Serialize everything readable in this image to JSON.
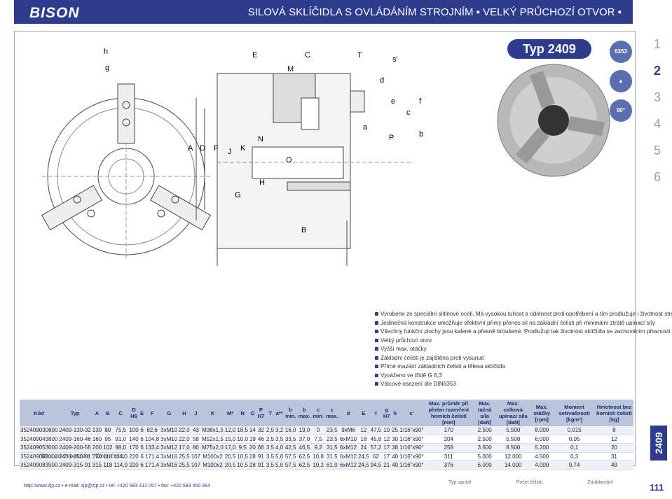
{
  "header": {
    "logo": "BISON",
    "title": "SILOVÁ SKLÍČIDLA S OVLÁDÁNÍM STROJNÍM ▪ VELKÝ PRŮCHOZÍ OTVOR ▪"
  },
  "side_tabs": [
    "1",
    "2",
    "3",
    "4",
    "5",
    "6"
  ],
  "active_tab": "2",
  "code_tab": "2409",
  "typ_label": "Typ 2409",
  "badges": {
    "din": "6353",
    "deg": "90°"
  },
  "drawing_labels": {
    "h": "h",
    "g": "g",
    "E": "E",
    "C": "C",
    "T": "T",
    "s": "s'",
    "M": "M",
    "d": "d",
    "e": "e",
    "c": "c",
    "f": "f",
    "a": "a",
    "P": "P",
    "b": "b",
    "A": "A",
    "D": "D",
    "F": "F",
    "J": "J",
    "K": "K",
    "N": "N",
    "O": "O",
    "G": "G",
    "H": "H",
    "B": "B"
  },
  "features": [
    "Vyrobeno ze speciální slitinové oceli. Má vysokou tuhost a odolnost proti opotřebení a tím prodlužuje i životnost stroje",
    "Jedinečná konstrukce umožňuje efektivní přímý přenos sil na základní čelisti při minimální ztrátě upínací síly",
    "Všechny funkční plochy jsou kalené a přesně broušené. Prodlužují tak životnost sklíčidla se zachováním přesnosti upínání",
    "Velký průchozí otvor",
    "Vyšší max. otáčky",
    "Základní čelisti je zajištěna proti vysunutí",
    "Přímé mazání základních čelistí a tělesa sklíčidla",
    "Vyváženo ve třídě G 6,3",
    "Válcové osazení dle DIN6353"
  ],
  "table": {
    "headers": [
      "Kód",
      "Typ",
      "A",
      "B",
      "C",
      "D H6",
      "E",
      "F",
      "G",
      "H",
      "J",
      "K",
      "M*",
      "N",
      "O",
      "P H7",
      "T",
      "a**",
      "b min.",
      "b max.",
      "c min.",
      "c max.",
      "d",
      "E",
      "f",
      "g H7",
      "h",
      "s'",
      "Max. průměr při plném rozevření horních čelistí [mm]",
      "Max. tažná síla [daN]",
      "Max. celková upínací síla [daN]",
      "Max. otáčky [rpm]",
      "Moment setrvačnosti [kgm²]",
      "Hmotnost bez horních čelistí [kg]"
    ],
    "rows": [
      [
        "352409030800",
        "2409-130-32",
        "130",
        "80",
        "75,5",
        "100",
        "6",
        "82,6",
        "3xM10",
        "22,0",
        "43",
        "M38x1,5",
        "12,0",
        "18,5",
        "14",
        "32",
        "2,5",
        "3,2",
        "16,0",
        "19,0",
        "0",
        "23,5",
        "9xM6",
        "12",
        "47,5",
        "10",
        "25",
        "1/16\"x90°",
        "170",
        "2.500",
        "5.500",
        "8.000",
        "0,015",
        "8"
      ],
      [
        "352409043800",
        "2409-160-46",
        "160",
        "95",
        "91,0",
        "140",
        "6",
        "104,8",
        "3xM10",
        "22,0",
        "58",
        "M52x1,5",
        "15,0",
        "10,0",
        "19",
        "46",
        "2,5",
        "3,5",
        "33,5",
        "37,0",
        "7,5",
        "23,5",
        "6xM10",
        "18",
        "45,8",
        "12",
        "30",
        "1/16\"x90°",
        "204",
        "2.500",
        "5.500",
        "6.000",
        "0,05",
        "12"
      ],
      [
        "352409053000",
        "2409-200-55",
        "200",
        "102",
        "98,0",
        "170",
        "6",
        "133,4",
        "3xM12",
        "17,0",
        "80",
        "M75x2,0",
        "17,0",
        "9,5",
        "20",
        "66",
        "3,5",
        "4,0",
        "42,5",
        "46,5",
        "9,2",
        "31,5",
        "6xM12",
        "24",
        "57,2",
        "17",
        "38",
        "1/16\"x90°",
        "258",
        "3.500",
        "8.500",
        "5.200",
        "0,1",
        "20"
      ],
      [
        "352409063100",
        "2409-250-91",
        "250",
        "118",
        "114,0",
        "220",
        "6",
        "171,4",
        "3xM16",
        "25,5",
        "107",
        "M100x2",
        "20,5",
        "10,5",
        "28",
        "91",
        "3,5",
        "5,0",
        "57,5",
        "62,5",
        "10,8",
        "31,5",
        "6xM12",
        "24,5",
        "62",
        "17",
        "40",
        "1/16\"x90°",
        "311",
        "5.000",
        "12.000",
        "4.500",
        "0,3",
        "31"
      ],
      [
        "352409083500",
        "2409-315-91",
        "315",
        "118",
        "114,0",
        "220",
        "6",
        "171,4",
        "3xM16",
        "25,5",
        "107",
        "M100x2",
        "20,5",
        "10,5",
        "28",
        "91",
        "3,5",
        "5,0",
        "57,5",
        "62,5",
        "10,2",
        "61,0",
        "6xM12",
        "24,5",
        "94,5",
        "21",
        "40",
        "1/16\"x90°",
        "376",
        "6.000",
        "14.000",
        "4.000",
        "0,74",
        "49"
      ]
    ]
  },
  "note": "*Max. zdvih pouzdra  **Zdvih čelisti",
  "footer": "http://www.zjp.cz  •  e-mail: zjp@zjp.cz  •  tel: +420 583 412 057  •  fax: +420 583 450 364",
  "footer_icons": [
    "Typ upnutí",
    "Počet čelistí",
    "Zoubkování"
  ],
  "page_number": "111",
  "colors": {
    "brand": "#2d3c8f",
    "table_header": "#b9c4dd"
  }
}
